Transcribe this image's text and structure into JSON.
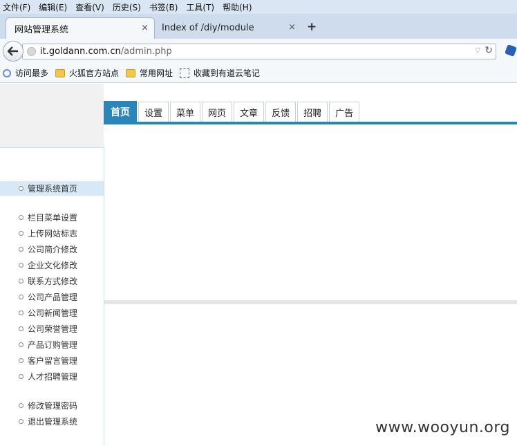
{
  "menu": [
    "文件(F)",
    "编辑(E)",
    "查看(V)",
    "历史(S)",
    "书签(B)",
    "工具(T)",
    "帮助(H)"
  ],
  "tabs": [
    {
      "title": "网站管理系统",
      "close": "×"
    },
    {
      "title": "Index of /diy/module",
      "close": "×"
    }
  ],
  "new_tab": "+",
  "nav": {
    "back": "⮐",
    "url_host": "it.goldann.com.cn",
    "url_path": "/admin.php",
    "dropdown": "▽",
    "reload": "↻"
  },
  "bookmarks": [
    {
      "label": "访问最多",
      "icon": "magnifier-icon"
    },
    {
      "label": "火狐官方站点",
      "icon": "folder-icon"
    },
    {
      "label": "常用网址",
      "icon": "folder-icon"
    },
    {
      "label": "收藏到有道云笔记",
      "icon": "note-icon"
    }
  ],
  "top_nav": [
    "首页",
    "设置",
    "菜单",
    "网页",
    "文章",
    "反馈",
    "招聘",
    "广告"
  ],
  "sidebar": {
    "home": "管理系统首页",
    "group1": [
      "栏目菜单设置",
      "上传网站标志",
      "公司简介修改",
      "企业文化修改",
      "联系方式修改",
      "公司产品管理",
      "公司新闻管理",
      "公司荣誉管理",
      "产品订购管理",
      "客户留言管理",
      "人才招聘管理"
    ],
    "group2": [
      "修改管理密码",
      "退出管理系统"
    ]
  },
  "watermark": "www.wooyun.org",
  "colors": {
    "accent": "#2a86b8",
    "sidebar_active": "#d7e9f7"
  }
}
